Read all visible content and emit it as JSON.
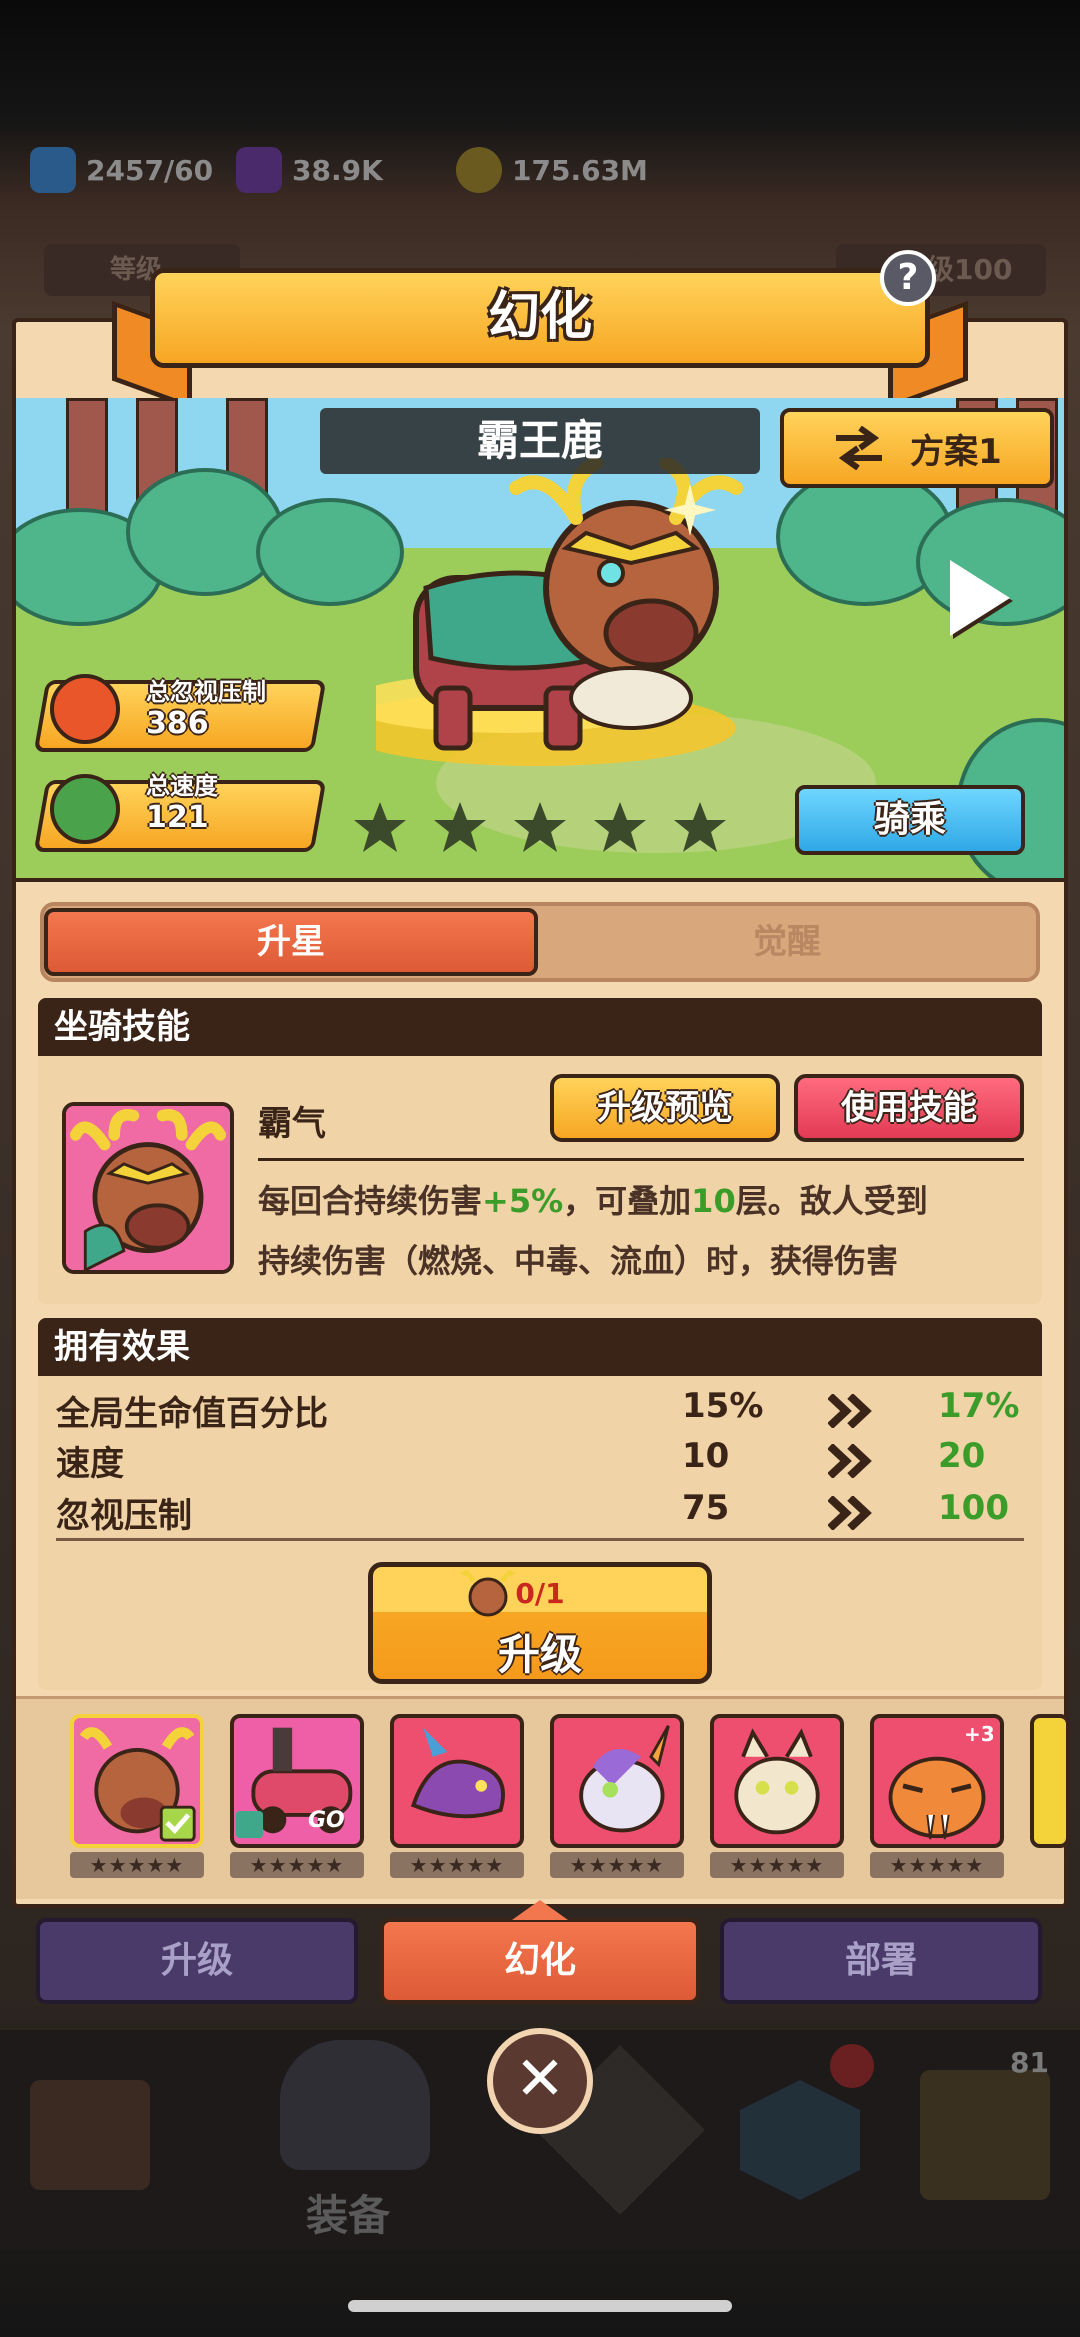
{
  "resources": [
    {
      "icon": "energy-icon",
      "value": "2457/60"
    },
    {
      "icon": "gem-icon",
      "value": "38.9K"
    },
    {
      "icon": "coin-icon",
      "value": "175.63M"
    }
  ],
  "background_row": {
    "left_label": "等级",
    "right_label": "级100"
  },
  "title": "幻化",
  "mount": {
    "name": "霸王鹿",
    "plan_label": "方案1",
    "stats": [
      {
        "label": "总忽视压制",
        "value": "386"
      },
      {
        "label": "总速度",
        "value": "121"
      }
    ],
    "stars": 5,
    "ride_label": "骑乘"
  },
  "tabs": {
    "star": "升星",
    "awaken": "觉醒"
  },
  "skill": {
    "section_title": "坐骑技能",
    "name": "霸气",
    "preview_label": "升级预览",
    "use_label": "使用技能",
    "desc_line1_a": "每回合持续伤害",
    "desc_line1_b": "+5%",
    "desc_line1_c": "，可叠加",
    "desc_line1_d": "10",
    "desc_line1_e": "层。敌人受到",
    "desc_line2": "持续伤害（燃烧、中毒、流血）时，获得伤害"
  },
  "effects": {
    "section_title": "拥有效果",
    "rows": [
      {
        "name": "全局生命值百分比",
        "current": "15%",
        "next": "17%"
      },
      {
        "name": "速度",
        "current": "10",
        "next": "20"
      },
      {
        "name": "忽视压制",
        "current": "75",
        "next": "100"
      }
    ]
  },
  "upgrade": {
    "cost": "0/1",
    "label": "升级"
  },
  "mount_list": [
    {
      "name": "deer",
      "color": "#f06aa3",
      "selected": true,
      "badge": ""
    },
    {
      "name": "car",
      "color": "#ee5fa8",
      "selected": false,
      "badge": "GO"
    },
    {
      "name": "dragon",
      "color": "#ee4f6e",
      "selected": false,
      "badge": ""
    },
    {
      "name": "unicorn",
      "color": "#ee4f6e",
      "selected": false,
      "badge": ""
    },
    {
      "name": "mummy",
      "color": "#ee4f6e",
      "selected": false,
      "badge": ""
    },
    {
      "name": "tiger",
      "color": "#ee4f6e",
      "selected": false,
      "badge": "+3"
    }
  ],
  "bottom_tabs": {
    "upgrade": "升级",
    "transform": "幻化",
    "deploy": "部署"
  },
  "nav": {
    "equip_label": "装备",
    "badge_count": "81"
  },
  "colors": {
    "accent_orange": "#f7a623",
    "dark_brown": "#3a2418",
    "green": "#3c9c2a",
    "panel": "#f4d9b0"
  }
}
